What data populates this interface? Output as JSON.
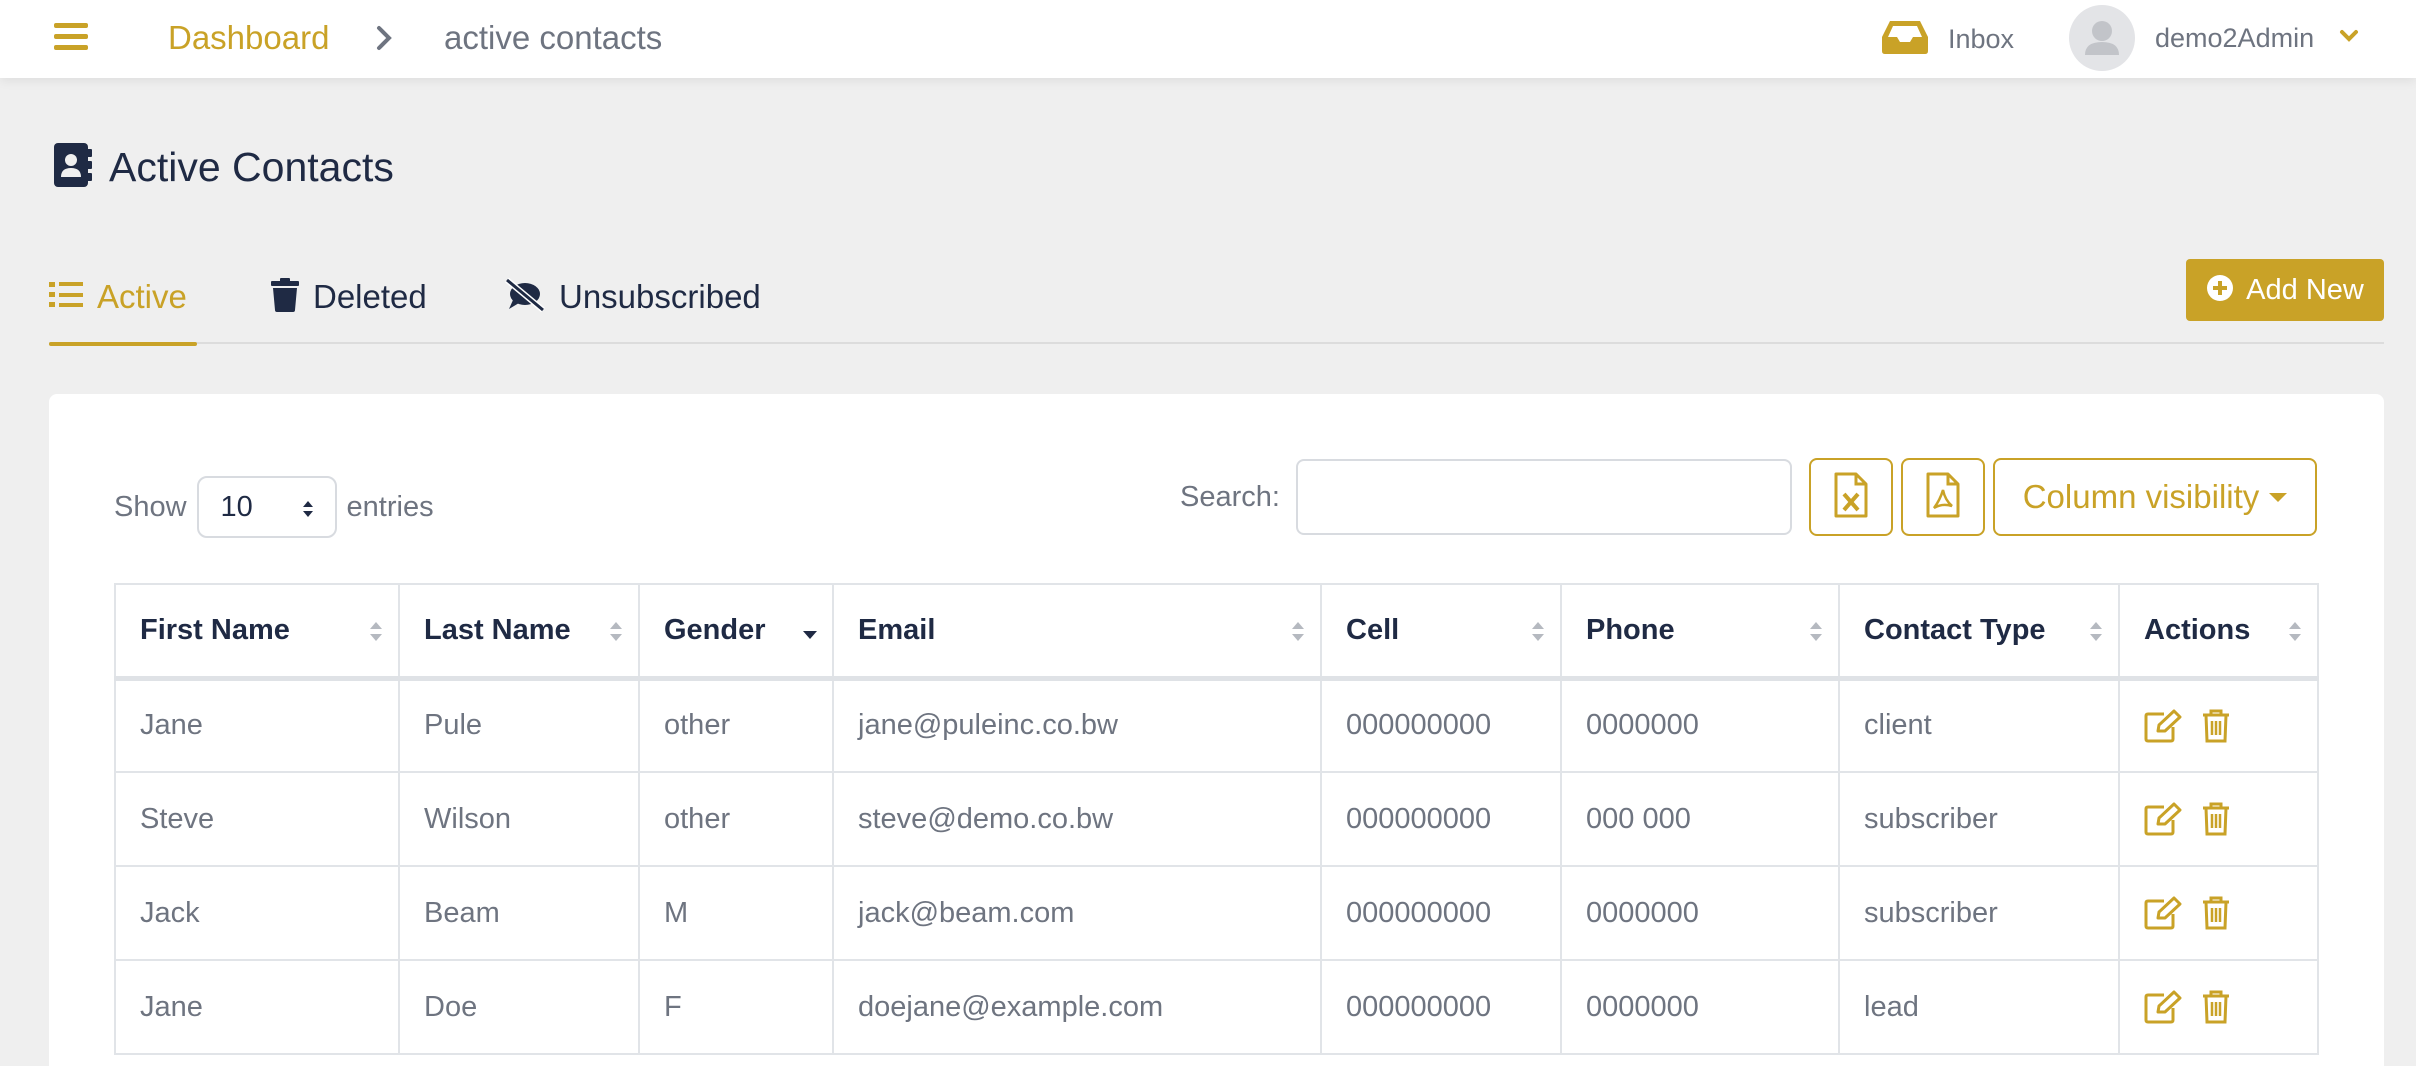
{
  "header": {
    "breadcrumb_link": "Dashboard",
    "breadcrumb_current": "active contacts",
    "inbox_label": "Inbox",
    "user_name": "demo2Admin"
  },
  "page": {
    "title": "Active Contacts"
  },
  "tabs": [
    {
      "label": "Active",
      "icon": "list-icon",
      "active": true
    },
    {
      "label": "Deleted",
      "icon": "trash-icon",
      "active": false
    },
    {
      "label": "Unsubscribed",
      "icon": "comment-slash-icon",
      "active": false
    }
  ],
  "actions": {
    "add_new_label": "Add New"
  },
  "controls": {
    "show_label": "Show",
    "entries_value": "10",
    "entries_label": "entries",
    "search_label": "Search:",
    "search_value": "",
    "column_visibility_label": "Column visibility"
  },
  "table": {
    "columns": [
      "First Name",
      "Last Name",
      "Gender",
      "Email",
      "Cell",
      "Phone",
      "Contact Type",
      "Actions"
    ],
    "sorted_column": "Gender",
    "sort_direction": "descending",
    "rows": [
      [
        "Jane",
        "Pule",
        "other",
        "jane@puleinc.co.bw",
        "000000000",
        "0000000",
        "client"
      ],
      [
        "Steve",
        "Wilson",
        "other",
        "steve@demo.co.bw",
        "000000000",
        "000 000",
        "subscriber"
      ],
      [
        "Jack",
        "Beam",
        "M",
        "jack@beam.com",
        "000000000",
        "0000000",
        "subscriber"
      ],
      [
        "Jane",
        "Doe",
        "F",
        "doejane@example.com",
        "000000000",
        "0000000",
        "lead"
      ]
    ]
  },
  "colors": {
    "accent": "#c9a227",
    "text_dark": "#1f2a44",
    "text_muted": "#6e7480",
    "background": "#efefef"
  }
}
